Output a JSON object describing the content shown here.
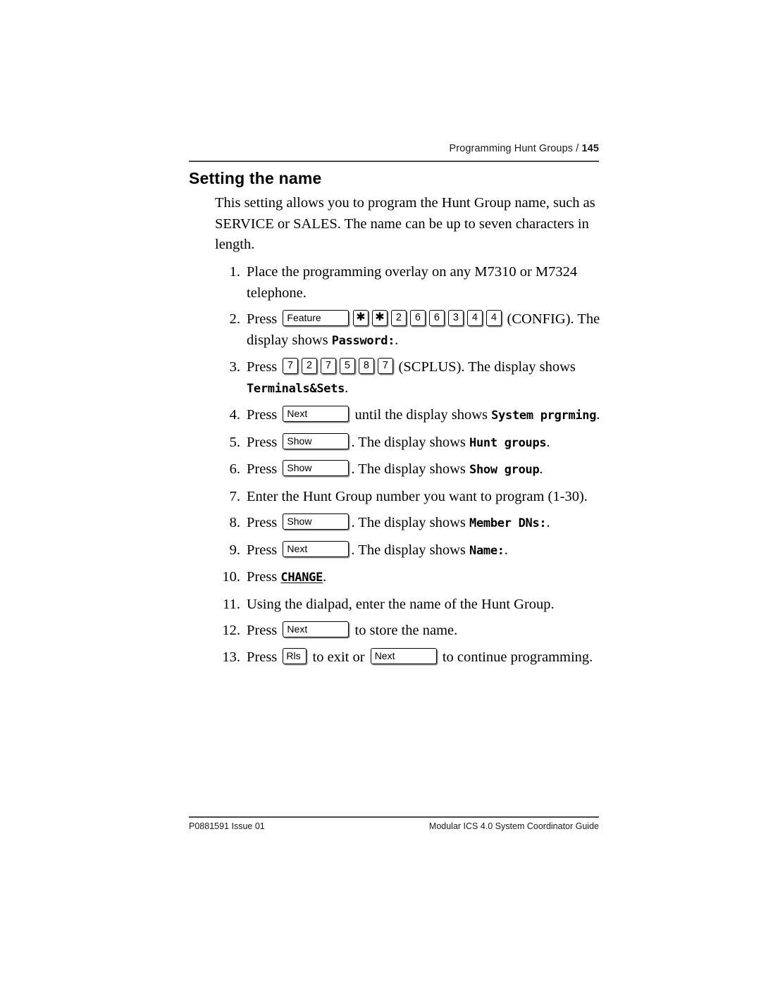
{
  "header": {
    "running_title": "Programming Hunt Groups /",
    "page_number": "145"
  },
  "heading": "Setting the name",
  "intro": "This setting allows you to program the Hunt Group name, such as SERVICE or SALES. The name can be up to seven characters in length.",
  "steps": [
    {
      "num": "1.",
      "pre": "Place the programming overlay on any M7310 or M7324 telephone.",
      "post": ""
    },
    {
      "num": "2.",
      "pre": "Press ",
      "keys": [
        "Feature",
        "*",
        "*",
        "2",
        "6",
        "6",
        "3",
        "4",
        "4"
      ],
      "mid": " (CONFIG). The display shows ",
      "lcd": "Password:",
      "post": "."
    },
    {
      "num": "3.",
      "pre": "Press ",
      "keys": [
        "7",
        "2",
        "7",
        "5",
        "8",
        "7"
      ],
      "mid": " (SCPLUS). The display shows ",
      "lcd": "Terminals&Sets",
      "post": "."
    },
    {
      "num": "4.",
      "pre": "Press ",
      "keys": [
        "Next"
      ],
      "mid": " until the display shows ",
      "lcd": "System prgrming",
      "post": "."
    },
    {
      "num": "5.",
      "pre": "Press ",
      "keys": [
        "Show"
      ],
      "mid": ". The display shows ",
      "lcd": "Hunt groups",
      "post": "."
    },
    {
      "num": "6.",
      "pre": "Press ",
      "keys": [
        "Show"
      ],
      "mid": ". The display shows ",
      "lcd": "Show group",
      "post": "."
    },
    {
      "num": "7.",
      "pre": "Enter the Hunt Group number you want to program (1-30).",
      "post": ""
    },
    {
      "num": "8.",
      "pre": "Press ",
      "keys": [
        "Show"
      ],
      "mid": ". The display shows ",
      "lcd": "Member DNs:",
      "post": "."
    },
    {
      "num": "9.",
      "pre": "Press ",
      "keys": [
        "Next"
      ],
      "mid": ". The display shows ",
      "lcd": "Name:",
      "post": "."
    },
    {
      "num": "10.",
      "pre": "Press ",
      "softkey": "CHANGE",
      "post": "."
    },
    {
      "num": "11.",
      "pre": "Using the dialpad, enter the name of the Hunt Group.",
      "post": ""
    },
    {
      "num": "12.",
      "pre": "Press ",
      "keys": [
        "Next"
      ],
      "mid": " to store the name.",
      "post": ""
    },
    {
      "num": "13.",
      "pre": "Press ",
      "keys": [
        "Rls"
      ],
      "mid": " to exit or ",
      "keys2": [
        "Next"
      ],
      "post": " to continue programming."
    }
  ],
  "footer": {
    "left": "P0881591 Issue 01",
    "right": "Modular ICS 4.0 System Coordinator Guide"
  }
}
